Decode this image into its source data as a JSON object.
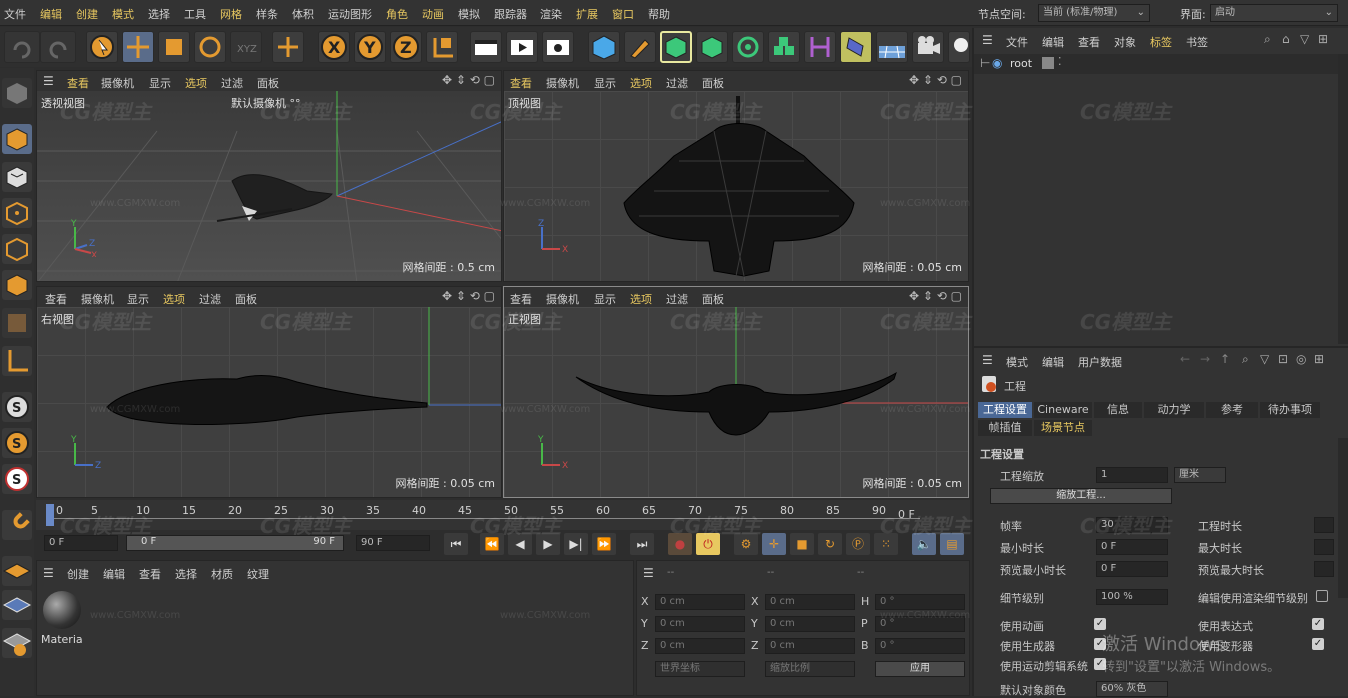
{
  "menubar": {
    "items": [
      "文件",
      "编辑",
      "创建",
      "模式",
      "选择",
      "工具",
      "网格",
      "样条",
      "体积",
      "运动图形",
      "角色",
      "动画",
      "模拟",
      "跟踪器",
      "渲染",
      "扩展",
      "窗口",
      "帮助"
    ],
    "node_space_label": "节点空间:",
    "node_space_value": "当前 (标准/物理)",
    "layout_label": "界面:",
    "layout_value": "启动"
  },
  "viewports": {
    "menu": [
      "查看",
      "摄像机",
      "显示",
      "选项",
      "过滤",
      "面板"
    ],
    "perspective": {
      "name": "透视视图",
      "camera": "默认摄像机 °°",
      "grid": "网格间距 : 0.5 cm"
    },
    "top": {
      "name": "顶视图",
      "grid": "网格间距 : 0.05 cm"
    },
    "right": {
      "name": "右视图",
      "grid": "网格间距 : 0.05 cm"
    },
    "front": {
      "name": "正视图",
      "grid": "网格间距 : 0.05 cm"
    }
  },
  "object_manager": {
    "menu": [
      "文件",
      "编辑",
      "查看",
      "对象",
      "标签",
      "书签"
    ],
    "root": "root"
  },
  "timeline": {
    "ticks": [
      "0",
      "5",
      "10",
      "15",
      "20",
      "25",
      "30",
      "35",
      "40",
      "45",
      "50",
      "55",
      "60",
      "65",
      "70",
      "75",
      "80",
      "85",
      "90"
    ],
    "current_frame": "0 F",
    "start": "0 F",
    "range_start": "0 F",
    "range_end": "90 F",
    "end": "90 F",
    "frame_readout": "0 F"
  },
  "material_manager": {
    "menu": [
      "创建",
      "编辑",
      "查看",
      "选择",
      "材质",
      "纹理"
    ],
    "material_name": "Materia"
  },
  "coords": {
    "rows": [
      {
        "a": "X",
        "av": "0 cm",
        "b": "X",
        "bv": "0 cm",
        "c": "H",
        "cv": "0 °"
      },
      {
        "a": "Y",
        "av": "0 cm",
        "b": "Y",
        "bv": "0 cm",
        "c": "P",
        "cv": "0 °"
      },
      {
        "a": "Z",
        "av": "0 cm",
        "b": "Z",
        "bv": "0 cm",
        "c": "B",
        "cv": "0 °"
      }
    ],
    "world": "世界坐标",
    "scale": "缩放比例",
    "apply": "应用",
    "header_dashes": "--"
  },
  "attributes": {
    "menu": [
      "模式",
      "编辑",
      "用户数据"
    ],
    "title": "工程",
    "tabs": [
      "工程设置",
      "Cineware",
      "信息",
      "动力学",
      "参考",
      "待办事项"
    ],
    "tabs2": [
      "帧插值",
      "场景节点"
    ],
    "section": "工程设置",
    "scale_label": "工程缩放",
    "scale_value": "1",
    "scale_unit": "厘米",
    "scale_button": "缩放工程...",
    "fps_label": "帧率",
    "fps_value": "30",
    "length_label": "工程时长",
    "min_label": "最小时长",
    "min_value": "0 F",
    "max_label": "最大时长",
    "pmin_label": "预览最小时长",
    "pmin_value": "0 F",
    "pmax_label": "预览最大时长",
    "lod_label": "细节级别",
    "lod_value": "100 %",
    "render_lod_label": "编辑使用渲染细节级别",
    "anim_label": "使用动画",
    "expr_label": "使用表达式",
    "gen_label": "使用生成器",
    "deform_label": "使用变形器",
    "motion_label": "使用运动剪辑系统",
    "default_color_label": "默认对象颜色",
    "default_color_value": "60% 灰色",
    "activate_line1": "激活 Windows",
    "activate_line2": "转到\"设置\"以激活 Windows。"
  },
  "watermark": {
    "logo": "CG模型主",
    "url": "www.CGMXW.com"
  }
}
